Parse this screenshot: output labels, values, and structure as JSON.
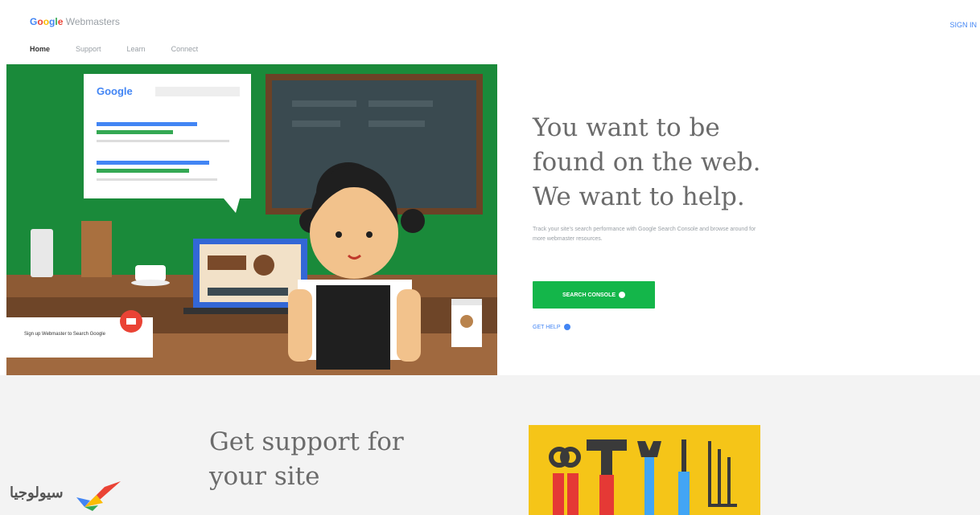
{
  "header": {
    "brand_google": "Google",
    "brand_product": "Webmasters",
    "signin_label": "SIGN IN",
    "nav": [
      "Home",
      "Support",
      "Learn",
      "Connect"
    ]
  },
  "hero": {
    "headline_line1": "You want to be",
    "headline_line2": "found on the web.",
    "headline_line3": "We want to help.",
    "subtext": "Track your site's search performance with Google Search Console and browse around for more webmaster resources.",
    "cta_label": "SEARCH CONSOLE",
    "secondary_label": "GET HELP",
    "search_card_brand": "Google",
    "toast_text": "Sign up Webmaster to Search Google"
  },
  "support": {
    "title_line1": "Get support for",
    "title_line2": "your site"
  },
  "watermark": {
    "logo_text": "سيولوجيا"
  },
  "colors": {
    "accent_green": "#14b64a",
    "link_blue": "#4285F4",
    "hero_green": "#1a8a3a"
  }
}
